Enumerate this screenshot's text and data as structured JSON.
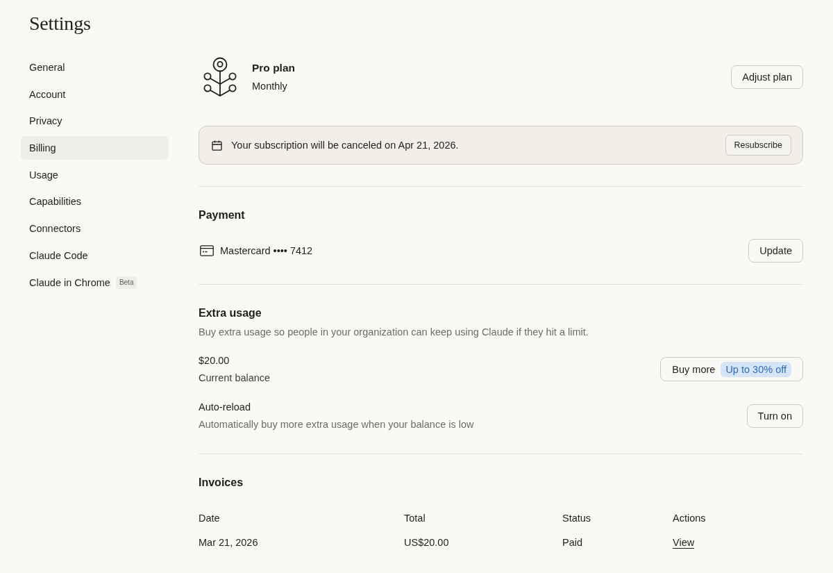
{
  "title": "Settings",
  "sidebar": {
    "items": [
      {
        "label": "General",
        "selected": false
      },
      {
        "label": "Account",
        "selected": false
      },
      {
        "label": "Privacy",
        "selected": false
      },
      {
        "label": "Billing",
        "selected": true
      },
      {
        "label": "Usage",
        "selected": false
      },
      {
        "label": "Capabilities",
        "selected": false
      },
      {
        "label": "Connectors",
        "selected": false
      },
      {
        "label": "Claude Code",
        "selected": false
      },
      {
        "label": "Claude in Chrome",
        "selected": false,
        "badge": "Beta"
      }
    ]
  },
  "plan": {
    "name": "Pro plan",
    "period": "Monthly",
    "button": "Adjust plan"
  },
  "notice": {
    "text": "Your subscription will be canceled on Apr 21, 2026.",
    "button": "Resubscribe"
  },
  "payment": {
    "heading": "Payment",
    "card": "Mastercard •••• 7412",
    "button": "Update"
  },
  "extra_usage": {
    "heading": "Extra usage",
    "description": "Buy extra usage so people in your organization can keep using Claude if they hit a limit.",
    "balance": {
      "amount": "$20.00",
      "label": "Current balance",
      "button": "Buy more",
      "badge": "Up to 30% off"
    },
    "auto_reload": {
      "label": "Auto-reload",
      "description": "Automatically buy more extra usage when your balance is low",
      "button": "Turn on"
    }
  },
  "invoices": {
    "heading": "Invoices",
    "columns": [
      "Date",
      "Total",
      "Status",
      "Actions"
    ],
    "rows": [
      {
        "date": "Mar 21, 2026",
        "total": "US$20.00",
        "status": "Paid",
        "action": "View"
      }
    ]
  }
}
